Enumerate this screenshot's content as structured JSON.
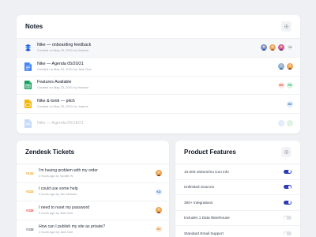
{
  "colors": {
    "toggle_on": "#2f3bb8",
    "toggle_off": "#dde0e5",
    "ticket_open": "#f59e0b",
    "ticket_urgent": "#ef4444",
    "ticket_closed": "#6b7280"
  },
  "notes": {
    "title": "Notes",
    "settings_icon": "gear-icon",
    "items": [
      {
        "title": "Nike — onboarding feedback",
        "meta": "Created on May 23, 2021 by Howem",
        "icon": "dropbox-paper-icon",
        "extra": "+4"
      },
      {
        "title": "Nike — Agenda 05/20/21",
        "meta": "Created on May 23, 2021 by Jane Doe",
        "icon": "google-docs-icon"
      },
      {
        "title": "Features Available",
        "meta": "Created on May 23, 2021 by Howem",
        "icon": "google-sheets-icon",
        "initials": [
          "MB",
          "PK"
        ]
      },
      {
        "title": "Nike & tonik — pitch",
        "meta": "Created on May 23, 2021 by Joanne",
        "icon": "google-slides-icon",
        "initials": [
          "MZ"
        ]
      },
      {
        "title": "Nike — Agenda 05/18/21",
        "meta": "",
        "icon": "google-docs-icon"
      }
    ]
  },
  "zendesk": {
    "title": "Zendesk Tickets",
    "tickets": [
      {
        "id": "#134",
        "title": "I'm having problem with my order",
        "meta": "2 hours ago by Scottie W",
        "status": "open"
      },
      {
        "id": "#323",
        "title": "I could use some help",
        "meta": "2 hours ago by Jan Jackson",
        "status": "open",
        "initials": "KD"
      },
      {
        "id": "#326",
        "title": "I need to reset my password",
        "meta": "2 hours ago by Jane Doe",
        "status": "urgent"
      },
      {
        "id": "#338",
        "title": "How can I publish my site as private?",
        "meta": "2 hours ago by Jane Doe",
        "status": "closed",
        "initials": "MJ"
      }
    ]
  },
  "features": {
    "title": "Product Features",
    "settings_icon": "gear-icon",
    "items": [
      {
        "label": "10.000 visitors/mo icon info",
        "on": true
      },
      {
        "label": "Unlimited Sources",
        "on": true
      },
      {
        "label": "300+ Integrations",
        "on": true
      },
      {
        "label": "Includes 1 Data Warehouse",
        "on": false
      },
      {
        "label": "Standard Email Support",
        "on": false
      }
    ]
  }
}
